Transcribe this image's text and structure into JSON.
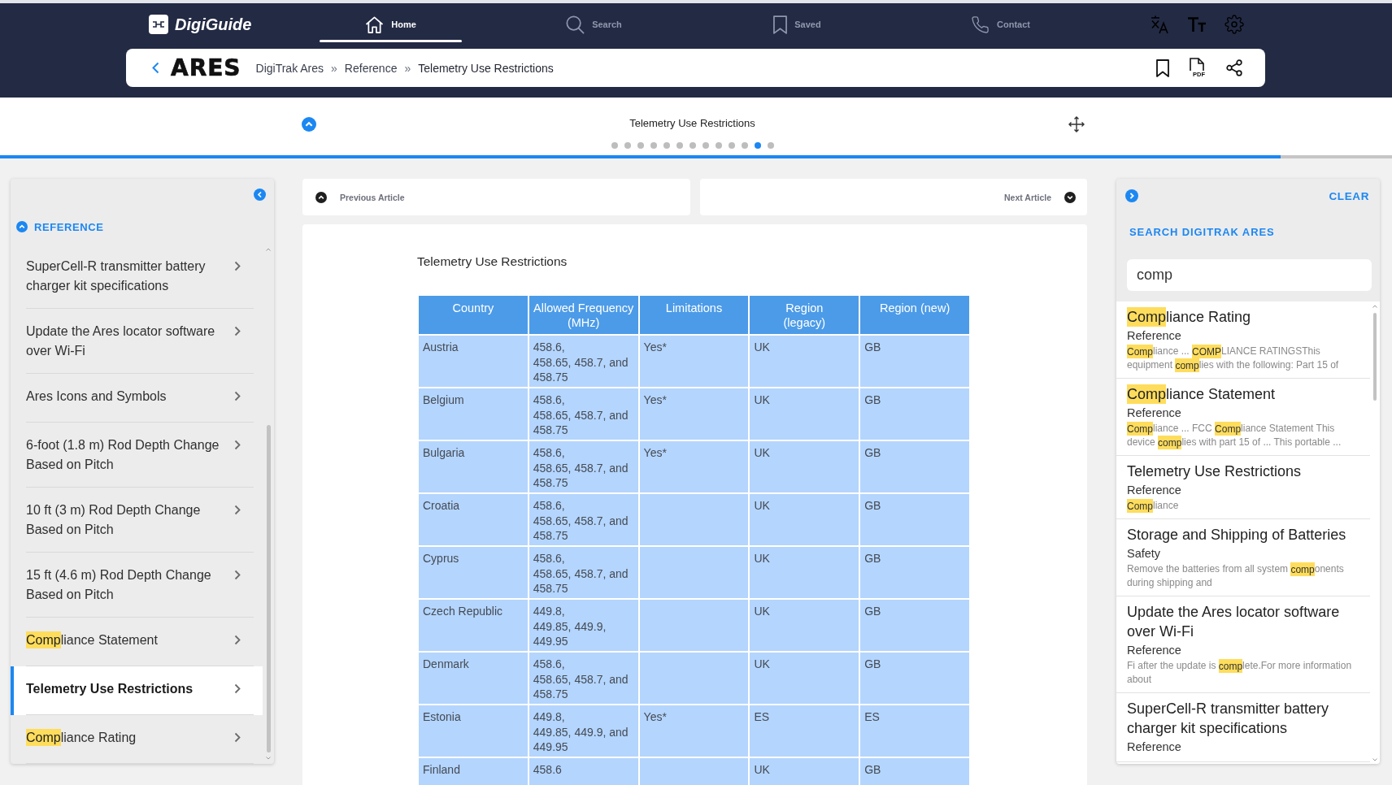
{
  "app": {
    "name": "DigiGuide"
  },
  "nav": [
    {
      "label": "Home",
      "selected": true
    },
    {
      "label": "Search",
      "selected": false
    },
    {
      "label": "Saved",
      "selected": false
    },
    {
      "label": "Contact",
      "selected": false
    }
  ],
  "product": {
    "logo": "ARES"
  },
  "breadcrumb": [
    {
      "kind": "link",
      "text": "DigiTrak Ares"
    },
    {
      "kind": "separator",
      "text": "»"
    },
    {
      "kind": "link",
      "text": "Reference"
    },
    {
      "kind": "separator",
      "text": "»"
    },
    {
      "kind": "current",
      "text": "Telemetry Use Restrictions"
    }
  ],
  "toolbar": {
    "pdf_label": "PDF"
  },
  "article_bar": {
    "title": "Telemetry Use Restrictions",
    "pages": [
      {
        "selected": false
      },
      {
        "selected": false
      },
      {
        "selected": false
      },
      {
        "selected": false
      },
      {
        "selected": false
      },
      {
        "selected": false
      },
      {
        "selected": false
      },
      {
        "selected": false
      },
      {
        "selected": false
      },
      {
        "selected": false
      },
      {
        "selected": false
      },
      {
        "selected": true
      },
      {
        "selected": false
      }
    ],
    "progress": {
      "level": 0.92
    }
  },
  "sidebar": {
    "section": {
      "title": "REFERENCE",
      "expanded": true
    },
    "items": [
      {
        "title": [
          {
            "text": "SuperCell-R transmitter battery charger kit specifications",
            "highlighted": false
          }
        ],
        "selected": false
      },
      {
        "title": [
          {
            "text": "Update the Ares locator software over Wi-Fi",
            "highlighted": false
          }
        ],
        "selected": false
      },
      {
        "title": [
          {
            "text": "Ares Icons and Symbols",
            "highlighted": false
          }
        ],
        "selected": false
      },
      {
        "title": [
          {
            "text": "6-foot (1.8 m) Rod Depth Change Based on Pitch",
            "highlighted": false
          }
        ],
        "selected": false
      },
      {
        "title": [
          {
            "text": "10 ft (3 m) Rod Depth Change Based on Pitch",
            "highlighted": false
          }
        ],
        "selected": false
      },
      {
        "title": [
          {
            "text": "15 ft (4.6 m) Rod Depth Change Based on Pitch",
            "highlighted": false
          }
        ],
        "selected": false
      },
      {
        "title": [
          {
            "text": "Comp",
            "highlighted": true
          },
          {
            "text": "liance Statement",
            "highlighted": false
          }
        ],
        "selected": false
      },
      {
        "title": [
          {
            "text": "Telemetry Use Restrictions",
            "highlighted": false
          }
        ],
        "selected": true
      },
      {
        "title": [
          {
            "text": "Comp",
            "highlighted": true
          },
          {
            "text": "liance Rating",
            "highlighted": false
          }
        ],
        "selected": false
      }
    ]
  },
  "article_nav": {
    "previous": "Previous Article",
    "next": "Next Article"
  },
  "article": {
    "title": "Telemetry Use Restrictions",
    "table": {
      "columns": [
        "Country",
        "Allowed Frequency (MHz)",
        "Limitations",
        "Region\n(legacy)",
        "Region (new)"
      ],
      "rows": [
        {
          "country": "Austria",
          "frequency": "458.6,\n458.65, 458.7, and 458.75",
          "limitations": "Yes*",
          "region_legacy": "UK",
          "region_new": "GB"
        },
        {
          "country": "Belgium",
          "frequency": "458.6,\n458.65, 458.7, and 458.75",
          "limitations": "Yes*",
          "region_legacy": "UK",
          "region_new": "GB"
        },
        {
          "country": "Bulgaria",
          "frequency": "458.6,\n458.65, 458.7, and 458.75",
          "limitations": "Yes*",
          "region_legacy": "UK",
          "region_new": "GB"
        },
        {
          "country": "Croatia",
          "frequency": "458.6,\n458.65, 458.7, and 458.75",
          "region_legacy": "UK",
          "region_new": "GB"
        },
        {
          "country": "Cyprus",
          "frequency": "458.6,\n458.65, 458.7, and 458.75",
          "region_legacy": "UK",
          "region_new": "GB"
        },
        {
          "country": "Czech Republic",
          "frequency": "449.8,\n449.85, 449.9, 449.95",
          "region_legacy": "UK",
          "region_new": "GB"
        },
        {
          "country": "Denmark",
          "frequency": "458.6,\n458.65, 458.7, and 458.75",
          "region_legacy": "UK",
          "region_new": "GB"
        },
        {
          "country": "Estonia",
          "frequency": "449.8,\n449.85, 449.9, and 449.95",
          "limitations": "Yes*",
          "region_legacy": "ES",
          "region_new": "ES"
        },
        {
          "country": "Finland",
          "frequency": "458.6",
          "region_legacy": "UK",
          "region_new": "GB"
        }
      ]
    }
  },
  "search_panel": {
    "clear": "CLEAR",
    "title": "SEARCH DIGITRAK ARES",
    "query": "comp",
    "results": [
      {
        "title": [
          {
            "text": "Comp",
            "highlighted": true
          },
          {
            "text": "liance Rating",
            "highlighted": false
          }
        ],
        "category": "Reference",
        "snippet": [
          {
            "text": "Comp",
            "highlighted": true
          },
          {
            "text": "liance ... ",
            "highlighted": false
          },
          {
            "text": "COMP",
            "highlighted": true
          },
          {
            "text": "LIANCE RATINGSThis equipment ",
            "highlighted": false
          },
          {
            "text": "comp",
            "highlighted": true
          },
          {
            "text": "lies with the following: Part 15 of",
            "highlighted": false
          }
        ]
      },
      {
        "title": [
          {
            "text": "Comp",
            "highlighted": true
          },
          {
            "text": "liance Statement",
            "highlighted": false
          }
        ],
        "category": "Reference",
        "snippet": [
          {
            "text": "Comp",
            "highlighted": true
          },
          {
            "text": "liance ... FCC ",
            "highlighted": false
          },
          {
            "text": "Comp",
            "highlighted": true
          },
          {
            "text": "liance Statement This device ",
            "highlighted": false
          },
          {
            "text": "comp",
            "highlighted": true
          },
          {
            "text": "lies with part 15 of ... This portable ...",
            "highlighted": false
          }
        ]
      },
      {
        "title": [
          {
            "text": "Telemetry Use Restrictions",
            "highlighted": false
          }
        ],
        "category": "Reference",
        "snippet": [
          {
            "text": "Comp",
            "highlighted": true
          },
          {
            "text": "liance",
            "highlighted": false
          }
        ]
      },
      {
        "title": [
          {
            "text": "Storage and Shipping of Batteries",
            "highlighted": false
          }
        ],
        "category": "Safety",
        "snippet": [
          {
            "text": "Remove the batteries from all system ",
            "highlighted": false
          },
          {
            "text": "comp",
            "highlighted": true
          },
          {
            "text": "onents during shipping and",
            "highlighted": false
          }
        ]
      },
      {
        "title": [
          {
            "text": "Update the Ares locator software over Wi-Fi",
            "highlighted": false
          }
        ],
        "category": "Reference",
        "snippet": [
          {
            "text": "Fi after the update is ",
            "highlighted": false
          },
          {
            "text": "comp",
            "highlighted": true
          },
          {
            "text": "lete.For more information about",
            "highlighted": false
          }
        ]
      },
      {
        "title": [
          {
            "text": "SuperCell-R transmitter battery charger kit specifications",
            "highlighted": false
          }
        ],
        "category": "Reference"
      }
    ]
  }
}
